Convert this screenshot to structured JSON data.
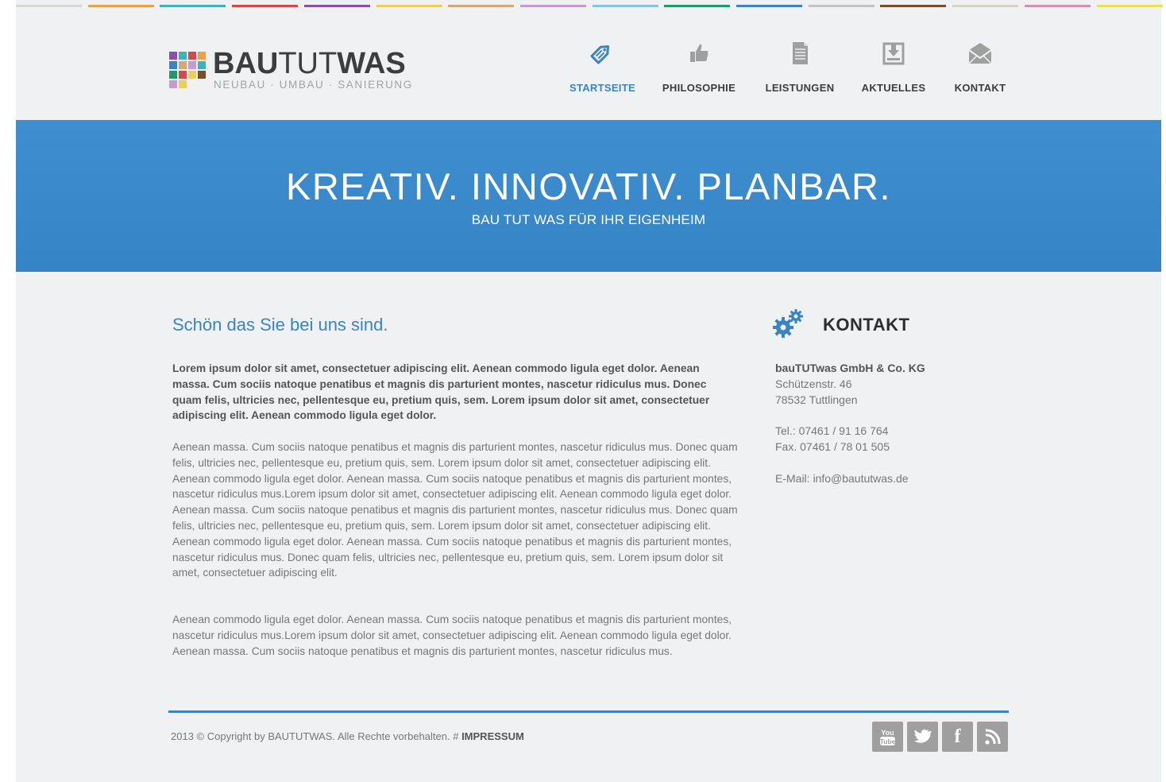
{
  "strip_colors": [
    "#d4d7d2",
    "#e9a24a",
    "#3fb3b8",
    "#d34a4a",
    "#8a4fa8",
    "#ead05a",
    "#d6a878",
    "#c79bd0",
    "#86c2e2",
    "#1e9a6a",
    "#3a84c4",
    "#c3c3c3",
    "#7a4c2a",
    "#d9d2c6",
    "#d58fb0",
    "#ece155"
  ],
  "logo": {
    "bold": "BAU",
    "thin": "TUT",
    "bold2": "WAS",
    "tagline": "NEUBAU · UMBAU · SANIERUNG",
    "grid_colors": [
      "#8b50a8",
      "#3fb3b8",
      "#d44a4a",
      "#e9a24a",
      "#3a84c4",
      "#d6a878",
      "#c79bd0",
      "#3fb3b8",
      "#1e9a6a",
      "#d34a4a",
      "#ead05a",
      "#7a4c2a",
      "#c79bd0",
      "#ead05a"
    ]
  },
  "nav": [
    {
      "label": "STARTSEITE",
      "icon": "tag-icon",
      "active": true
    },
    {
      "label": "PHILOSOPHIE",
      "icon": "thumbs-up-icon",
      "active": false
    },
    {
      "label": "LEISTUNGEN",
      "icon": "document-icon",
      "active": false
    },
    {
      "label": "AKTUELLES",
      "icon": "download-icon",
      "active": false
    },
    {
      "label": "KONTAKT",
      "icon": "envelope-icon",
      "active": false
    }
  ],
  "hero": {
    "title": "KREATIV. INNOVATIV. PLANBAR.",
    "subtitle": "BAU TUT WAS FÜR IHR EIGENHEIM"
  },
  "main": {
    "heading": "Schön das Sie bei uns sind.",
    "lead": "Lorem ipsum dolor sit amet, consectetuer adipiscing elit. Aenean commodo ligula eget dolor. Aenean massa. Cum sociis natoque penatibus et magnis dis parturient montes, nascetur ridiculus mus. Donec quam felis, ultricies nec, pellentesque eu, pretium quis, sem. Lorem ipsum dolor sit amet, consectetuer adipiscing elit. Aenean commodo ligula eget dolor.",
    "paragraph1": "Aenean massa. Cum sociis natoque penatibus et magnis dis parturient montes, nascetur ridiculus mus. Donec quam felis, ultricies nec, pellentesque eu, pretium quis, sem. Lorem ipsum dolor sit amet, consectetuer adipiscing elit. Aenean commodo ligula eget dolor. Aenean massa. Cum sociis natoque penatibus et magnis dis parturient montes, nascetur ridiculus mus.Lorem ipsum dolor sit amet, consectetuer adipiscing elit. Aenean commodo ligula eget dolor. Aenean massa. Cum sociis natoque penatibus et magnis dis parturient montes, nascetur ridiculus mus. Donec quam felis, ultricies nec, pellentesque eu, pretium quis, sem. Lorem ipsum dolor sit amet, consectetuer adipiscing elit. Aenean commodo ligula eget dolor. Aenean massa. Cum sociis natoque penatibus et magnis dis parturient montes, nascetur ridiculus mus. Donec quam felis, ultricies nec, pellentesque eu, pretium quis, sem. Lorem ipsum dolor sit amet, consectetuer adipiscing elit.",
    "paragraph2": "Aenean commodo ligula eget dolor. Aenean massa. Cum sociis natoque penatibus et magnis dis parturient montes, nascetur ridiculus mus.Lorem ipsum dolor sit amet, consectetuer adipiscing elit. Aenean commodo ligula eget dolor. Aenean massa. Cum sociis natoque penatibus et magnis dis parturient montes, nascetur ridiculus mus."
  },
  "sidebar": {
    "heading": "KONTAKT",
    "icon": "gears-icon",
    "company": "bauTUTwas GmbH & Co. KG",
    "street": "Schützenstr. 46",
    "city": "78532 Tuttlingen",
    "tel": "Tel.: 07461 / 91 16 764",
    "fax": "Fax. 07461 / 78 01 505",
    "email": "E-Mail: info@baututwas.de"
  },
  "footer": {
    "copyright": "2013 © Copyright by BAUTUTWAS. Alle Rechte vorbehalten.  #",
    "impressum": "IMPRESSUM",
    "social": [
      {
        "name": "youtube-icon",
        "glyph_top": "You",
        "glyph_bottom": "Tube"
      },
      {
        "name": "twitter-icon"
      },
      {
        "name": "facebook-icon",
        "glyph": "f"
      },
      {
        "name": "rss-icon"
      }
    ]
  },
  "colors": {
    "accent": "#3a84c4",
    "background": "#eff1f2",
    "icon_gray": "#9f9f9f"
  }
}
